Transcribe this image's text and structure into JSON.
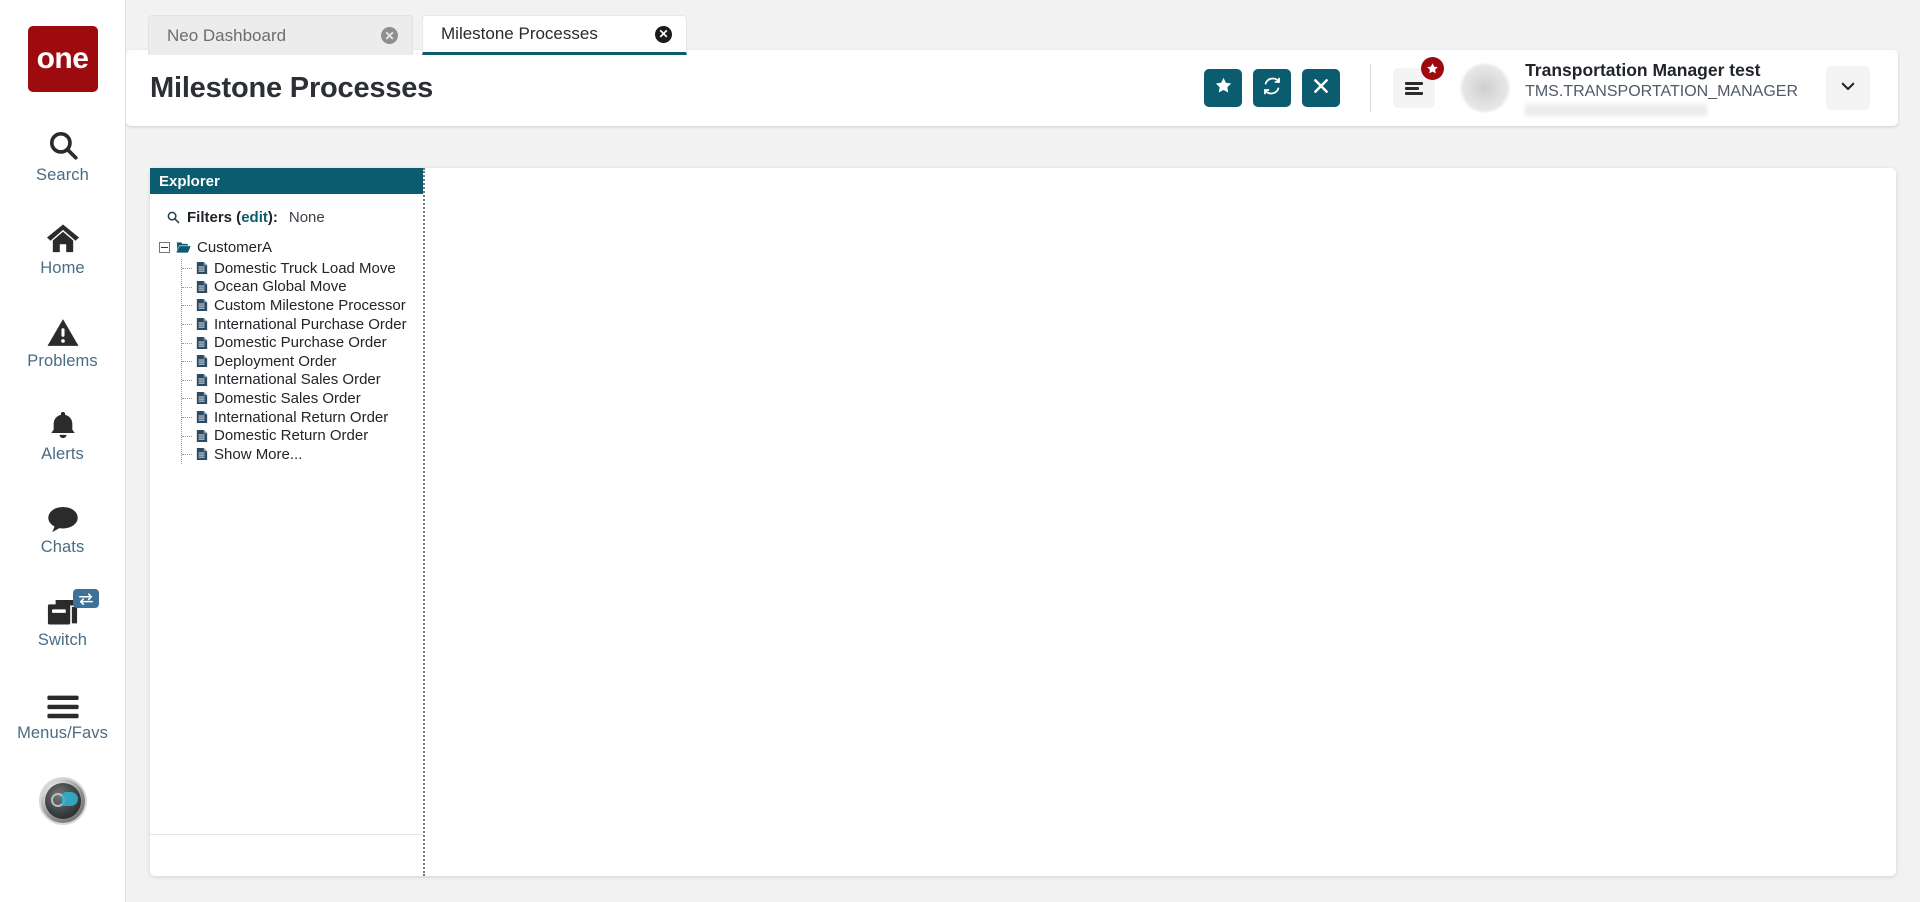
{
  "brand": {
    "logo_text": "one"
  },
  "nav_rail": {
    "items": [
      {
        "label": "Search",
        "icon": "search-icon"
      },
      {
        "label": "Home",
        "icon": "home-icon"
      },
      {
        "label": "Problems",
        "icon": "warning-triangle-icon"
      },
      {
        "label": "Alerts",
        "icon": "bell-icon"
      },
      {
        "label": "Chats",
        "icon": "chat-bubble-icon"
      },
      {
        "label": "Switch",
        "icon": "windows-stack-icon",
        "badge_icon": "swap-arrows-icon"
      },
      {
        "label": "Menus/Favs",
        "icon": "hamburger-icon"
      }
    ],
    "assistant_icon": "ai-assistant-orb-icon"
  },
  "tabs": [
    {
      "label": "Neo Dashboard",
      "active": false,
      "close_icon": "close-circle-icon"
    },
    {
      "label": "Milestone Processes",
      "active": true,
      "close_icon": "close-circle-icon"
    }
  ],
  "header": {
    "title": "Milestone Processes",
    "actions": [
      {
        "name": "favorite-button",
        "icon": "star-icon"
      },
      {
        "name": "refresh-button",
        "icon": "refresh-icon"
      },
      {
        "name": "close-button",
        "icon": "x-icon"
      }
    ],
    "menu_button": {
      "icon": "hamburger-icon",
      "badge_icon": "star-icon"
    },
    "user": {
      "name": "Transportation Manager test",
      "role": "TMS.TRANSPORTATION_MANAGER",
      "caret_icon": "chevron-down-icon",
      "avatar_icon": "avatar-icon"
    }
  },
  "explorer": {
    "title": "Explorer",
    "filters": {
      "icon": "search-icon",
      "label": "Filters (",
      "edit_label": "edit",
      "label_end": "):",
      "value": "None"
    },
    "tree": {
      "root": {
        "label": "CustomerA",
        "toggle": "collapse-minus-icon",
        "icon": "folder-open-icon"
      },
      "children": [
        {
          "label": "Domestic Truck Load Move",
          "icon": "document-icon"
        },
        {
          "label": "Ocean Global Move",
          "icon": "document-icon"
        },
        {
          "label": "Custom Milestone Processor",
          "icon": "document-icon"
        },
        {
          "label": "International Purchase Order",
          "icon": "document-icon"
        },
        {
          "label": "Domestic Purchase Order",
          "icon": "document-icon"
        },
        {
          "label": "Deployment Order",
          "icon": "document-icon"
        },
        {
          "label": "International Sales Order",
          "icon": "document-icon"
        },
        {
          "label": "Domestic Sales Order",
          "icon": "document-icon"
        },
        {
          "label": "International Return Order",
          "icon": "document-icon"
        },
        {
          "label": "Domestic Return Order",
          "icon": "document-icon"
        },
        {
          "label": "Show More...",
          "icon": "document-icon"
        }
      ]
    }
  },
  "colors": {
    "teal": "#0a5c6e",
    "brand_red": "#9e0b0f",
    "label_blue": "#4a6c82",
    "page_bg": "#f2f2f2"
  }
}
